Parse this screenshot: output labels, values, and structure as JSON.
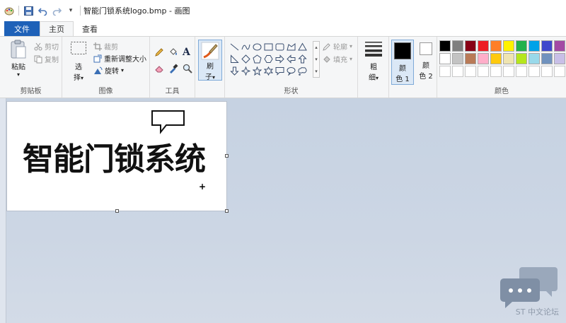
{
  "window": {
    "title": "智能门锁系统logo.bmp - 画图"
  },
  "tabs": [
    {
      "label": "文件"
    },
    {
      "label": "主页"
    },
    {
      "label": "查看"
    }
  ],
  "clipboard": {
    "paste_label": "粘贴",
    "cut_label": "剪切",
    "copy_label": "复制",
    "group_label": "剪贴板"
  },
  "image": {
    "select_label_1": "选",
    "select_label_2": "择",
    "crop_label": "裁剪",
    "resize_label": "重新调整大小",
    "rotate_label": "旋转",
    "group_label": "图像"
  },
  "tools": {
    "group_label": "工具",
    "text_glyph": "A"
  },
  "brushes": {
    "label_1": "刷",
    "label_2": "子"
  },
  "shapes": {
    "outline_label": "轮廓",
    "fill_label": "填充",
    "group_label": "形状"
  },
  "size": {
    "label_1": "粗",
    "label_2": "细"
  },
  "colors": {
    "color1_label_1": "颜",
    "color1_label_2": "色 1",
    "color2_label_1": "颜",
    "color2_label_2": "色 2",
    "group_label": "颜色",
    "color1": "#000000",
    "color2": "#ffffff",
    "palette": [
      "#000000",
      "#7f7f7f",
      "#880015",
      "#ed1c24",
      "#ff7f27",
      "#fff200",
      "#22b14c",
      "#00a2e8",
      "#3f48cc",
      "#a349a4",
      "#ffffff",
      "#c3c3c3",
      "#b97a57",
      "#ffaec9",
      "#ffc90e",
      "#efe4b0",
      "#b5e61d",
      "#99d9ea",
      "#7092be",
      "#c8bfe7",
      "#ffffff",
      "#ffffff",
      "#ffffff",
      "#ffffff",
      "#ffffff",
      "#ffffff",
      "#ffffff",
      "#ffffff",
      "#ffffff",
      "#ffffff"
    ]
  },
  "canvas": {
    "text": "智能门锁系统"
  },
  "watermark": {
    "text": "ST 中文论坛"
  }
}
